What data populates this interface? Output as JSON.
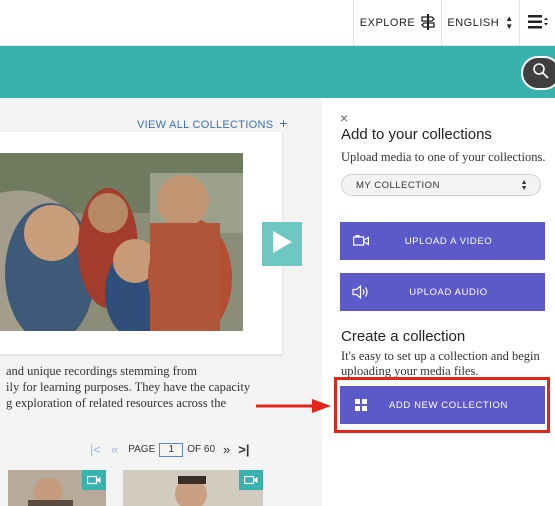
{
  "topbar": {
    "explore_label": "EXPLORE",
    "language_label": "ENGLISH"
  },
  "collections": {
    "view_all_label": "VIEW ALL COLLECTIONS",
    "description_lines": [
      "and unique recordings stemming from",
      "ily for learning purposes. They have the capacity",
      "g exploration of related resources across the"
    ]
  },
  "pager": {
    "page_label": "PAGE",
    "page_value": "1",
    "of_label": "OF 60"
  },
  "panel": {
    "close_label": "×",
    "add_title": "Add to your collections",
    "add_text": "Upload media to one of your collections.",
    "select_value": "MY COLLECTION",
    "upload_video_label": "UPLOAD A VIDEO",
    "upload_audio_label": "UPLOAD AUDIO",
    "create_title": "Create a collection",
    "create_text": "It's easy to set up a collection and begin uploading your media files.",
    "add_new_label": "ADD NEW COLLECTION"
  },
  "colors": {
    "teal": "#39b2ae",
    "button_purple": "#5c59c9",
    "highlight_red": "#e3261c",
    "link_blue": "#3b6fb5"
  },
  "icons": {
    "explore": "signpost-icon",
    "menu": "hamburger-menu-icon",
    "search": "magnifier-icon",
    "play": "play-icon",
    "video": "video-camera-icon",
    "audio": "speaker-icon",
    "grid": "grid-icon",
    "arrow": "red-arrow-annotation"
  }
}
